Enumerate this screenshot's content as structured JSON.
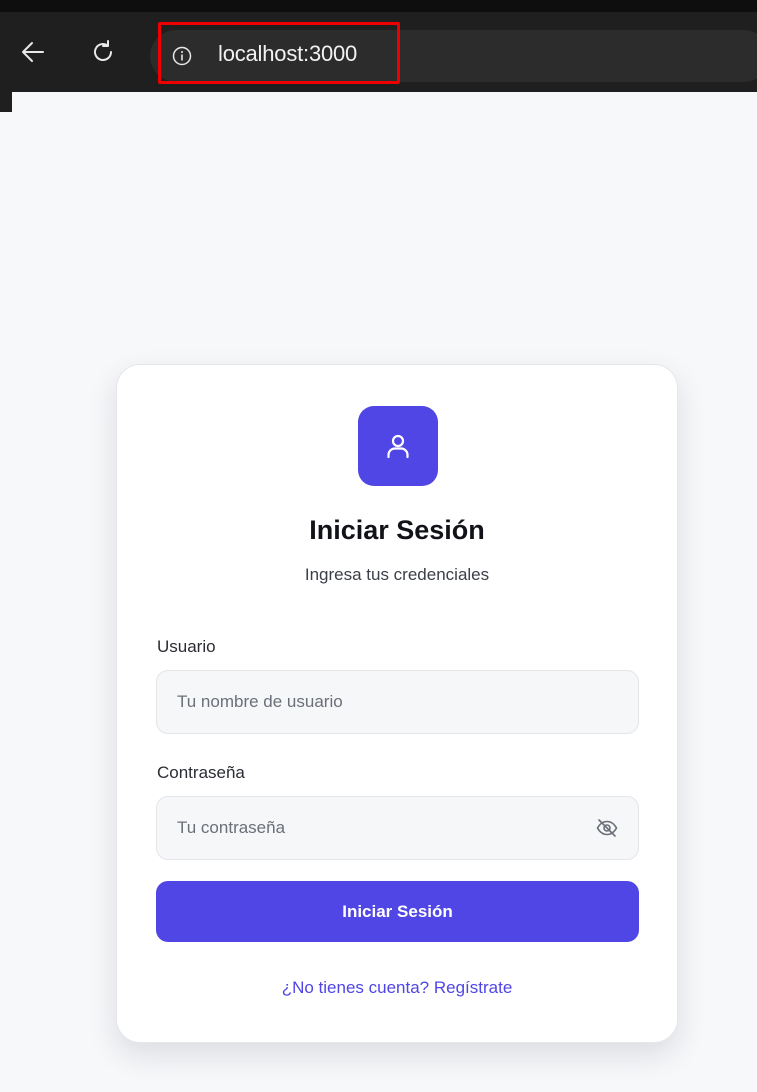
{
  "browser": {
    "url": "localhost:3000"
  },
  "login": {
    "title": "Iniciar Sesión",
    "subtitle": "Ingresa tus credenciales",
    "username_label": "Usuario",
    "username_placeholder": "Tu nombre de usuario",
    "username_value": "",
    "password_label": "Contraseña",
    "password_placeholder": "Tu contraseña",
    "password_value": "",
    "submit_label": "Iniciar Sesión",
    "register_link": "¿No tienes cuenta? Regístrate"
  },
  "icons": {
    "back": "arrow-left-icon",
    "reload": "reload-icon",
    "info": "info-icon",
    "avatar": "user-icon",
    "password_toggle": "eye-off-icon"
  },
  "colors": {
    "accent": "#5046e5",
    "link": "#4f46e5",
    "page_bg": "#f7f8fa",
    "highlight": "#ee0000"
  }
}
